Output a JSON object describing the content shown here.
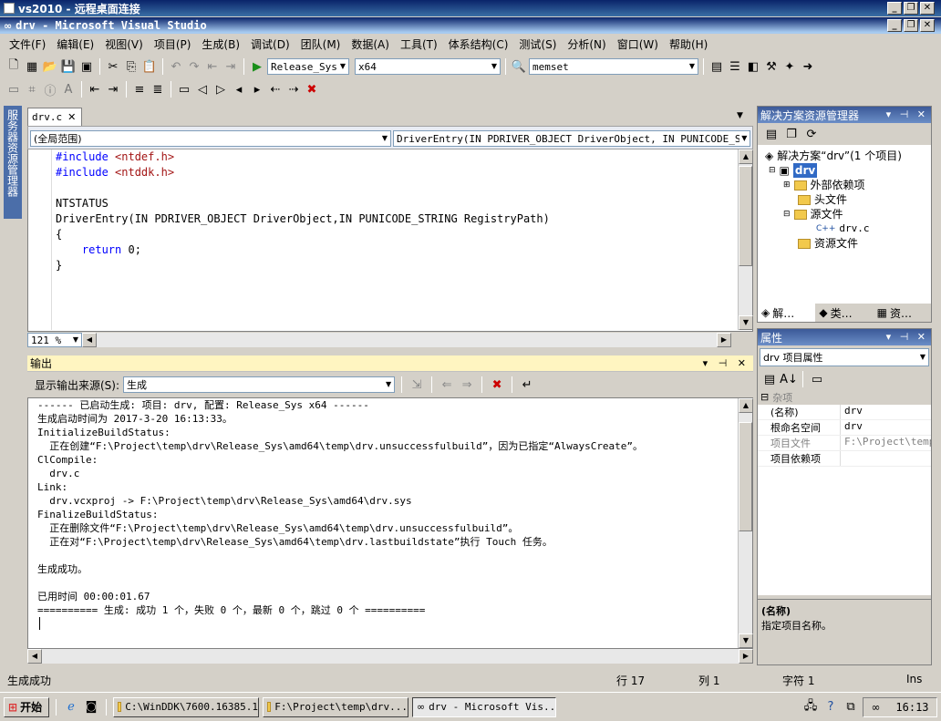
{
  "rdp": {
    "title": "vs2010 - 远程桌面连接"
  },
  "vs": {
    "title": "drv - Microsoft Visual Studio"
  },
  "menu": [
    "文件(F)",
    "编辑(E)",
    "视图(V)",
    "项目(P)",
    "生成(B)",
    "调试(D)",
    "团队(M)",
    "数据(A)",
    "工具(T)",
    "体系结构(C)",
    "测试(S)",
    "分析(N)",
    "窗口(W)",
    "帮助(H)"
  ],
  "toolbar": {
    "config": "Release_Sys",
    "platform": "x64",
    "find": "memset"
  },
  "editor": {
    "tab": "drv.c",
    "scope": "(全局范围)",
    "func": "DriverEntry(IN PDRIVER_OBJECT DriverObject, IN PUNICODE_STRI",
    "zoom": "121 %",
    "lines": [
      {
        "pre": "#include ",
        "str": "<ntdef.h>",
        "kw": true
      },
      {
        "pre": "#include ",
        "str": "<ntddk.h>",
        "kw": true
      },
      {
        "pre": "",
        "str": "",
        "kw": false
      },
      {
        "pre": "NTSTATUS",
        "str": "",
        "kw": false
      },
      {
        "pre": "DriverEntry(IN PDRIVER_OBJECT DriverObject,IN PUNICODE_STRING RegistryPath)",
        "str": "",
        "kw": false
      },
      {
        "pre": "{",
        "str": "",
        "kw": false
      },
      {
        "pre": "    ",
        "ret": "return",
        "post": " 0;",
        "kw": false
      },
      {
        "pre": "}",
        "str": "",
        "kw": false
      }
    ]
  },
  "left_tab": "服务器资源管理器",
  "output": {
    "title": "输出",
    "source_label": "显示输出来源(S):",
    "source_value": "生成",
    "lines": [
      "------ 已启动生成: 项目: drv, 配置: Release_Sys x64 ------",
      "生成启动时间为 2017-3-20 16:13:33。",
      "InitializeBuildStatus:",
      "  正在创建“F:\\Project\\temp\\drv\\Release_Sys\\amd64\\temp\\drv.unsuccessfulbuild”，因为已指定“AlwaysCreate”。",
      "ClCompile:",
      "  drv.c",
      "Link:",
      "  drv.vcxproj -> F:\\Project\\temp\\drv\\Release_Sys\\amd64\\drv.sys",
      "FinalizeBuildStatus:",
      "  正在删除文件“F:\\Project\\temp\\drv\\Release_Sys\\amd64\\temp\\drv.unsuccessfulbuild”。",
      "  正在对“F:\\Project\\temp\\drv\\Release_Sys\\amd64\\temp\\drv.lastbuildstate”执行 Touch 任务。",
      "",
      "生成成功。",
      "",
      "已用时间 00:00:01.67",
      "========== 生成: 成功 1 个，失败 0 个，最新 0 个，跳过 0 个 =========="
    ]
  },
  "solution": {
    "title": "解决方案资源管理器",
    "root": "解决方案“drv”(1 个项目)",
    "project": "drv",
    "items": [
      "外部依赖项",
      "头文件",
      "源文件",
      "drv.c",
      "资源文件"
    ],
    "tabs": [
      "解…",
      "类…",
      "资…"
    ]
  },
  "props": {
    "title": "属性",
    "object": "drv 项目属性",
    "category": "杂项",
    "rows": [
      {
        "k": "(名称)",
        "v": "drv"
      },
      {
        "k": "根命名空间",
        "v": "drv"
      },
      {
        "k": "项目文件",
        "v": "F:\\Project\\temp\\"
      },
      {
        "k": "项目依赖项",
        "v": ""
      }
    ],
    "desc_title": "(名称)",
    "desc_text": "指定项目名称。"
  },
  "status": {
    "text": "生成成功",
    "line": "行 17",
    "col": "列 1",
    "char": "字符 1",
    "mode": "Ins"
  },
  "taskbar": {
    "start": "开始",
    "buttons": [
      "C:\\WinDDK\\7600.16385.1",
      "F:\\Project\\temp\\drv...",
      "drv - Microsoft Vis..."
    ],
    "time": "16:13"
  }
}
